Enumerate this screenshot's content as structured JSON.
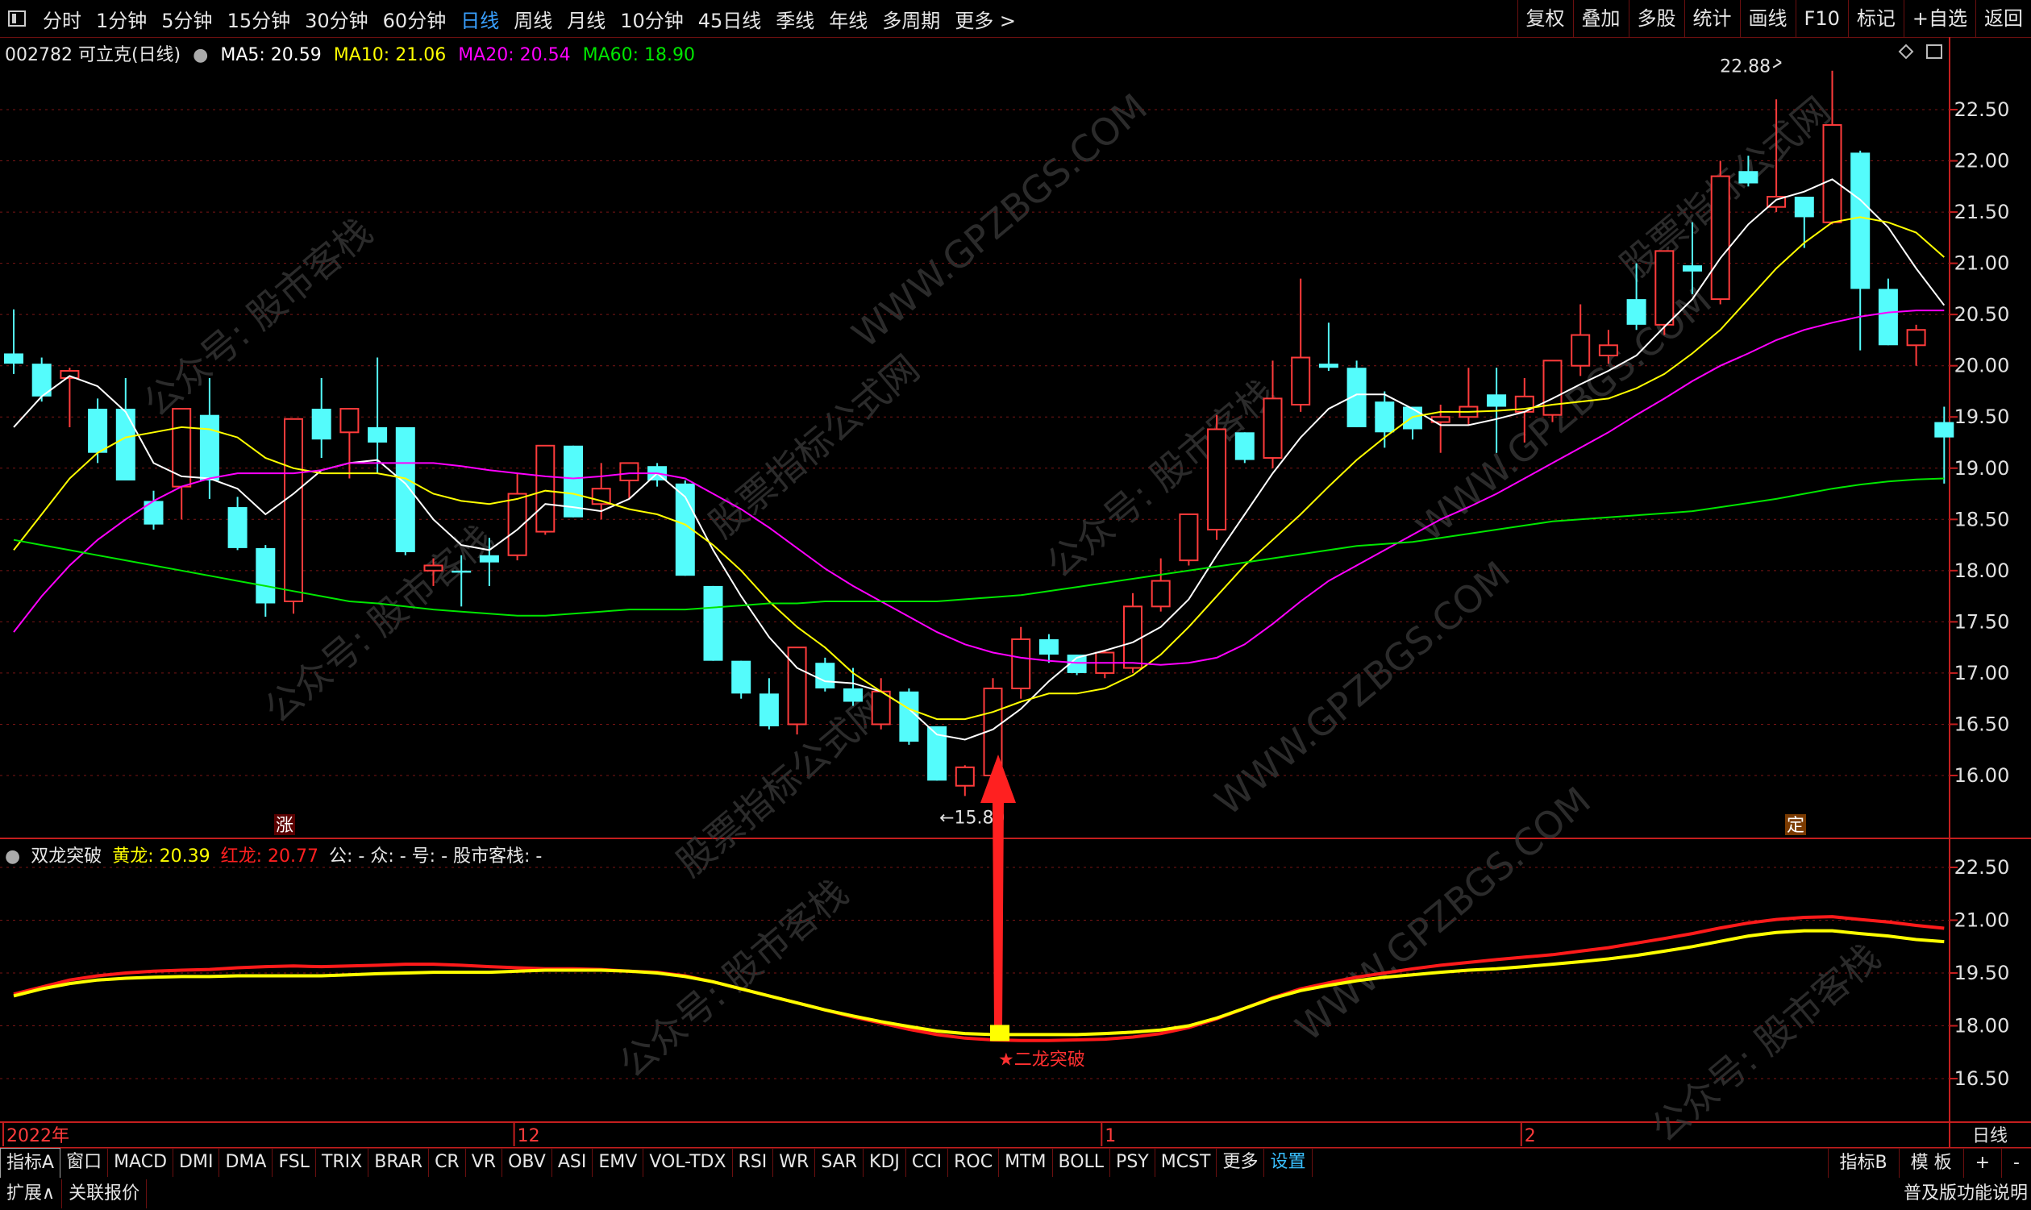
{
  "toolbar": {
    "periods": [
      "分时",
      "1分钟",
      "5分钟",
      "15分钟",
      "30分钟",
      "60分钟",
      "日线",
      "周线",
      "月线",
      "10分钟",
      "45日线",
      "季线",
      "年线",
      "多周期",
      "更多 >"
    ],
    "active_index": 6,
    "right_tools": [
      "复权",
      "叠加",
      "多股",
      "统计",
      "画线",
      "F10",
      "标记",
      "+自选",
      "返回"
    ]
  },
  "info": {
    "stock": "002782 可立克(日线)",
    "ma5": "MA5: 20.59",
    "ma10": "MA10: 21.06",
    "ma20": "MA20: 20.54",
    "ma60": "MA60: 18.90"
  },
  "indicator": {
    "name": "双龙突破",
    "yellow": "黄龙: 20.39",
    "red": "红龙: 20.77",
    "extra": "公: - 众: - 号: - 股市客栈: -"
  },
  "bottom_tabs": [
    "指标A",
    "窗口",
    "MACD",
    "DMI",
    "DMA",
    "FSL",
    "TRIX",
    "BRAR",
    "CR",
    "VR",
    "OBV",
    "ASI",
    "EMV",
    "VOL-TDX",
    "RSI",
    "WR",
    "SAR",
    "KDJ",
    "CCI",
    "ROC",
    "MTM",
    "BOLL",
    "PSY",
    "MCST",
    "更多",
    "设置"
  ],
  "bottom_right": [
    "指标B",
    "模 板",
    "+",
    "-"
  ],
  "status": {
    "items": [
      "扩展∧",
      "关联报价"
    ],
    "right": "普及版功能说明"
  },
  "colors": {
    "up": "#ff3b3b",
    "down": "#54fcfc",
    "ma5": "#ffffff",
    "ma10": "#ffff00",
    "ma20": "#ff00ff",
    "ma60": "#00e600",
    "axis": "#c41e1e"
  },
  "watermarks": [
    "公众号: 股市客栈",
    "WWW.GPZBGS.COM",
    "股票指标公式网"
  ],
  "chart_data": [
    {
      "type": "candlestick",
      "title": "002782 可立克(日线)",
      "ylim": [
        15.5,
        23.0
      ],
      "y_ticks": [
        "22.50",
        "22.00",
        "21.50",
        "21.00",
        "20.50",
        "20.00",
        "19.50",
        "19.00",
        "18.50",
        "18.00",
        "17.50",
        "17.00",
        "16.50",
        "16.00"
      ],
      "x_labels": [
        {
          "label": "2022年",
          "index": 0
        },
        {
          "label": "12",
          "index": 18
        },
        {
          "label": "1",
          "index": 39
        },
        {
          "label": "2",
          "index": 54
        }
      ],
      "candles": [
        {
          "o": 20.12,
          "h": 20.55,
          "l": 19.92,
          "c": 20.02
        },
        {
          "o": 20.02,
          "h": 20.08,
          "l": 19.65,
          "c": 19.7
        },
        {
          "o": 19.88,
          "h": 19.98,
          "l": 19.4,
          "c": 19.95
        },
        {
          "o": 19.58,
          "h": 19.68,
          "l": 19.05,
          "c": 19.15
        },
        {
          "o": 19.58,
          "h": 19.88,
          "l": 18.88,
          "c": 18.88
        },
        {
          "o": 18.68,
          "h": 18.78,
          "l": 18.4,
          "c": 18.45
        },
        {
          "o": 18.82,
          "h": 19.58,
          "l": 18.5,
          "c": 19.58
        },
        {
          "o": 19.52,
          "h": 19.88,
          "l": 18.7,
          "c": 18.88
        },
        {
          "o": 18.62,
          "h": 18.72,
          "l": 18.2,
          "c": 18.22
        },
        {
          "o": 18.22,
          "h": 18.25,
          "l": 17.55,
          "c": 17.68
        },
        {
          "o": 17.7,
          "h": 19.48,
          "l": 17.58,
          "c": 19.48
        },
        {
          "o": 19.58,
          "h": 19.88,
          "l": 19.1,
          "c": 19.28
        },
        {
          "o": 19.35,
          "h": 19.58,
          "l": 18.9,
          "c": 19.58
        },
        {
          "o": 19.4,
          "h": 20.08,
          "l": 18.95,
          "c": 19.25
        },
        {
          "o": 19.4,
          "h": 19.4,
          "l": 18.15,
          "c": 18.18
        },
        {
          "o": 18.0,
          "h": 18.12,
          "l": 17.85,
          "c": 18.05
        },
        {
          "o": 18.0,
          "h": 18.15,
          "l": 17.65,
          "c": 17.98
        },
        {
          "o": 18.15,
          "h": 18.32,
          "l": 17.85,
          "c": 18.08
        },
        {
          "o": 18.15,
          "h": 18.95,
          "l": 18.1,
          "c": 18.75
        },
        {
          "o": 18.38,
          "h": 19.22,
          "l": 18.35,
          "c": 19.22
        },
        {
          "o": 19.22,
          "h": 19.22,
          "l": 18.52,
          "c": 18.52
        },
        {
          "o": 18.65,
          "h": 19.05,
          "l": 18.5,
          "c": 18.8
        },
        {
          "o": 18.88,
          "h": 19.05,
          "l": 18.7,
          "c": 19.05
        },
        {
          "o": 19.02,
          "h": 19.05,
          "l": 18.82,
          "c": 18.88
        },
        {
          "o": 18.85,
          "h": 18.88,
          "l": 17.95,
          "c": 17.95
        },
        {
          "o": 17.85,
          "h": 17.85,
          "l": 17.12,
          "c": 17.12
        },
        {
          "o": 17.12,
          "h": 17.12,
          "l": 16.75,
          "c": 16.8
        },
        {
          "o": 16.8,
          "h": 16.95,
          "l": 16.45,
          "c": 16.48
        },
        {
          "o": 16.5,
          "h": 17.25,
          "l": 16.4,
          "c": 17.25
        },
        {
          "o": 17.1,
          "h": 17.15,
          "l": 16.82,
          "c": 16.85
        },
        {
          "o": 16.85,
          "h": 17.05,
          "l": 16.68,
          "c": 16.72
        },
        {
          "o": 16.5,
          "h": 16.95,
          "l": 16.45,
          "c": 16.82
        },
        {
          "o": 16.82,
          "h": 16.85,
          "l": 16.3,
          "c": 16.33
        },
        {
          "o": 16.48,
          "h": 16.48,
          "l": 15.95,
          "c": 15.95
        },
        {
          "o": 15.9,
          "h": 16.1,
          "l": 15.8,
          "c": 16.08
        },
        {
          "o": 16.0,
          "h": 16.95,
          "l": 15.85,
          "c": 16.85
        },
        {
          "o": 16.85,
          "h": 17.45,
          "l": 16.75,
          "c": 17.33
        },
        {
          "o": 17.33,
          "h": 17.38,
          "l": 17.1,
          "c": 17.18
        },
        {
          "o": 17.18,
          "h": 17.18,
          "l": 16.98,
          "c": 17.0
        },
        {
          "o": 17.0,
          "h": 17.22,
          "l": 16.95,
          "c": 17.2
        },
        {
          "o": 17.05,
          "h": 17.78,
          "l": 17.0,
          "c": 17.65
        },
        {
          "o": 17.65,
          "h": 18.12,
          "l": 17.6,
          "c": 17.9
        },
        {
          "o": 18.1,
          "h": 18.55,
          "l": 18.05,
          "c": 18.55
        },
        {
          "o": 18.4,
          "h": 19.52,
          "l": 18.3,
          "c": 19.38
        },
        {
          "o": 19.35,
          "h": 19.35,
          "l": 19.05,
          "c": 19.08
        },
        {
          "o": 19.1,
          "h": 20.05,
          "l": 19.0,
          "c": 19.68
        },
        {
          "o": 19.62,
          "h": 20.85,
          "l": 19.55,
          "c": 20.08
        },
        {
          "o": 20.02,
          "h": 20.42,
          "l": 19.95,
          "c": 19.98
        },
        {
          "o": 19.98,
          "h": 20.05,
          "l": 19.4,
          "c": 19.4
        },
        {
          "o": 19.65,
          "h": 19.75,
          "l": 19.2,
          "c": 19.35
        },
        {
          "o": 19.6,
          "h": 19.6,
          "l": 19.28,
          "c": 19.38
        },
        {
          "o": 19.45,
          "h": 19.62,
          "l": 19.15,
          "c": 19.5
        },
        {
          "o": 19.5,
          "h": 19.98,
          "l": 19.42,
          "c": 19.6
        },
        {
          "o": 19.72,
          "h": 19.98,
          "l": 19.15,
          "c": 19.6
        },
        {
          "o": 19.55,
          "h": 19.88,
          "l": 19.25,
          "c": 19.7
        },
        {
          "o": 19.52,
          "h": 20.05,
          "l": 19.45,
          "c": 20.05
        },
        {
          "o": 20.0,
          "h": 20.6,
          "l": 19.9,
          "c": 20.3
        },
        {
          "o": 20.1,
          "h": 20.35,
          "l": 20.02,
          "c": 20.2
        },
        {
          "o": 20.65,
          "h": 21.0,
          "l": 20.35,
          "c": 20.4
        },
        {
          "o": 20.4,
          "h": 21.12,
          "l": 20.3,
          "c": 21.12
        },
        {
          "o": 20.98,
          "h": 21.4,
          "l": 20.7,
          "c": 20.92
        },
        {
          "o": 20.65,
          "h": 22.0,
          "l": 20.6,
          "c": 21.85
        },
        {
          "o": 21.9,
          "h": 22.05,
          "l": 21.75,
          "c": 21.78
        },
        {
          "o": 21.55,
          "h": 22.6,
          "l": 21.5,
          "c": 21.65
        },
        {
          "o": 21.65,
          "h": 21.65,
          "l": 21.15,
          "c": 21.45
        },
        {
          "o": 21.4,
          "h": 22.88,
          "l": 21.38,
          "c": 22.35
        },
        {
          "o": 22.08,
          "h": 22.1,
          "l": 20.15,
          "c": 20.75
        },
        {
          "o": 20.75,
          "h": 20.85,
          "l": 20.2,
          "c": 20.2
        },
        {
          "o": 20.2,
          "h": 20.4,
          "l": 20.0,
          "c": 20.35
        },
        {
          "o": 19.45,
          "h": 19.6,
          "l": 18.85,
          "c": 19.3
        }
      ],
      "series": [
        {
          "name": "MA5",
          "color": "#ffffff",
          "values": [
            19.4,
            19.7,
            19.9,
            19.8,
            19.55,
            19.05,
            18.92,
            18.9,
            18.8,
            18.55,
            18.75,
            18.98,
            19.05,
            19.08,
            18.85,
            18.5,
            18.25,
            18.2,
            18.4,
            18.65,
            18.62,
            18.58,
            18.7,
            18.95,
            18.72,
            18.2,
            17.75,
            17.35,
            17.05,
            16.92,
            16.9,
            16.82,
            16.65,
            16.4,
            16.35,
            16.45,
            16.65,
            16.92,
            17.15,
            17.22,
            17.3,
            17.45,
            17.72,
            18.15,
            18.55,
            18.95,
            19.3,
            19.58,
            19.72,
            19.72,
            19.58,
            19.42,
            19.42,
            19.48,
            19.55,
            19.68,
            19.82,
            19.95,
            20.1,
            20.38,
            20.65,
            21.05,
            21.38,
            21.62,
            21.7,
            21.82,
            21.62,
            21.35,
            20.95,
            20.59
          ]
        },
        {
          "name": "MA10",
          "color": "#ffff00",
          "values": [
            18.2,
            18.55,
            18.9,
            19.15,
            19.3,
            19.35,
            19.4,
            19.38,
            19.3,
            19.1,
            19.0,
            18.95,
            18.95,
            18.95,
            18.9,
            18.75,
            18.68,
            18.65,
            18.7,
            18.78,
            18.75,
            18.68,
            18.6,
            18.55,
            18.45,
            18.25,
            18.0,
            17.7,
            17.45,
            17.25,
            17.0,
            16.82,
            16.65,
            16.55,
            16.55,
            16.62,
            16.72,
            16.8,
            16.8,
            16.85,
            16.98,
            17.18,
            17.45,
            17.75,
            18.05,
            18.3,
            18.55,
            18.82,
            19.08,
            19.3,
            19.5,
            19.55,
            19.55,
            19.56,
            19.58,
            19.62,
            19.65,
            19.68,
            19.78,
            19.92,
            20.12,
            20.35,
            20.65,
            20.95,
            21.2,
            21.4,
            21.45,
            21.4,
            21.3,
            21.06
          ]
        },
        {
          "name": "MA20",
          "color": "#ff00ff",
          "values": [
            17.4,
            17.75,
            18.05,
            18.3,
            18.5,
            18.68,
            18.82,
            18.9,
            18.95,
            18.95,
            18.95,
            18.98,
            19.05,
            19.05,
            19.05,
            19.05,
            19.02,
            18.98,
            18.95,
            18.92,
            18.9,
            18.92,
            18.95,
            18.95,
            18.9,
            18.75,
            18.6,
            18.42,
            18.22,
            18.02,
            17.85,
            17.7,
            17.55,
            17.4,
            17.28,
            17.2,
            17.15,
            17.12,
            17.1,
            17.1,
            17.1,
            17.08,
            17.1,
            17.15,
            17.28,
            17.48,
            17.7,
            17.9,
            18.05,
            18.2,
            18.35,
            18.5,
            18.62,
            18.75,
            18.9,
            19.05,
            19.2,
            19.35,
            19.52,
            19.68,
            19.85,
            20.0,
            20.12,
            20.25,
            20.35,
            20.42,
            20.48,
            20.52,
            20.54,
            20.54
          ]
        },
        {
          "name": "MA60",
          "color": "#00e600",
          "values": [
            18.3,
            18.25,
            18.2,
            18.15,
            18.1,
            18.05,
            18.0,
            17.95,
            17.9,
            17.85,
            17.8,
            17.75,
            17.7,
            17.68,
            17.65,
            17.62,
            17.6,
            17.58,
            17.56,
            17.56,
            17.58,
            17.6,
            17.62,
            17.62,
            17.62,
            17.64,
            17.66,
            17.68,
            17.68,
            17.7,
            17.7,
            17.7,
            17.7,
            17.7,
            17.72,
            17.74,
            17.76,
            17.8,
            17.84,
            17.88,
            17.92,
            17.96,
            18.0,
            18.04,
            18.08,
            18.12,
            18.16,
            18.2,
            18.24,
            18.26,
            18.28,
            18.32,
            18.36,
            18.4,
            18.44,
            18.48,
            18.5,
            18.52,
            18.54,
            18.56,
            18.58,
            18.62,
            18.66,
            18.7,
            18.75,
            18.8,
            18.84,
            18.87,
            18.89,
            18.9
          ]
        }
      ],
      "annotations": [
        {
          "text": "22.88",
          "index": 63,
          "value": 22.88
        },
        {
          "text": "←15.80",
          "index": 33,
          "value": 15.8
        },
        {
          "text": "涨",
          "index": 9
        },
        {
          "text": "定",
          "index": 63
        }
      ]
    },
    {
      "type": "line",
      "title": "双龙突破",
      "ylim": [
        15.5,
        23.0
      ],
      "y_ticks": [
        "22.50",
        "21.00",
        "19.50",
        "18.00",
        "16.50"
      ],
      "series": [
        {
          "name": "红龙",
          "color": "#ff1a1a",
          "values": [
            18.9,
            19.1,
            19.3,
            19.42,
            19.5,
            19.55,
            19.58,
            19.6,
            19.65,
            19.68,
            19.7,
            19.68,
            19.7,
            19.72,
            19.75,
            19.75,
            19.72,
            19.68,
            19.65,
            19.62,
            19.62,
            19.6,
            19.55,
            19.52,
            19.42,
            19.25,
            19.05,
            18.85,
            18.65,
            18.45,
            18.25,
            18.08,
            17.9,
            17.75,
            17.65,
            17.6,
            17.58,
            17.58,
            17.6,
            17.62,
            17.68,
            17.78,
            17.95,
            18.2,
            18.5,
            18.8,
            19.05,
            19.22,
            19.38,
            19.5,
            19.62,
            19.72,
            19.8,
            19.88,
            19.95,
            20.02,
            20.12,
            20.22,
            20.35,
            20.48,
            20.62,
            20.78,
            20.92,
            21.02,
            21.08,
            21.1,
            21.02,
            20.95,
            20.85,
            20.77
          ]
        },
        {
          "name": "黄龙",
          "color": "#ffff00",
          "values": [
            18.85,
            19.05,
            19.2,
            19.3,
            19.35,
            19.38,
            19.4,
            19.4,
            19.42,
            19.42,
            19.42,
            19.42,
            19.45,
            19.48,
            19.5,
            19.52,
            19.52,
            19.52,
            19.55,
            19.58,
            19.58,
            19.58,
            19.55,
            19.5,
            19.4,
            19.25,
            19.05,
            18.85,
            18.65,
            18.45,
            18.28,
            18.12,
            17.98,
            17.85,
            17.78,
            17.75,
            17.75,
            17.75,
            17.75,
            17.78,
            17.82,
            17.88,
            18.0,
            18.22,
            18.5,
            18.78,
            19.0,
            19.15,
            19.28,
            19.38,
            19.45,
            19.52,
            19.58,
            19.62,
            19.68,
            19.75,
            19.82,
            19.9,
            20.0,
            20.12,
            20.25,
            20.4,
            20.55,
            20.65,
            20.7,
            20.7,
            20.62,
            20.55,
            20.45,
            20.39
          ]
        }
      ],
      "annotations": [
        {
          "text": "★二龙突破",
          "index": 35
        }
      ]
    }
  ]
}
